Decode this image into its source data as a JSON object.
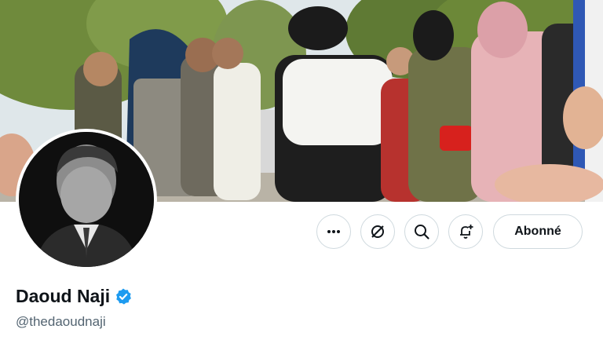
{
  "profile": {
    "display_name": "Daoud Naji",
    "handle": "@thedaoudnaji",
    "verified": true,
    "verified_badge_color": "#1d9bf0"
  },
  "actions": {
    "more_icon": "more-dots-icon",
    "grok_icon": "grok-icon",
    "search_icon": "search-icon",
    "notify_icon": "bell-plus-icon",
    "follow_label": "Abonné"
  },
  "colors": {
    "text_primary": "#0f1419",
    "text_secondary": "#536471",
    "button_border": "#cfd9de"
  }
}
